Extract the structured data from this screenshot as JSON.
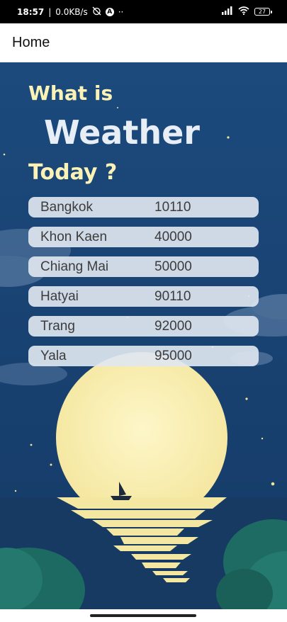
{
  "status_bar": {
    "time": "18:57",
    "network_speed": "0.0KB/s",
    "extra_dots": "··",
    "battery_level": "27"
  },
  "app_bar": {
    "title": "Home"
  },
  "header": {
    "line1": "What is",
    "line2": "Weather",
    "line3": "Today ?"
  },
  "cities": [
    {
      "name": "Bangkok",
      "code": "10110"
    },
    {
      "name": "Khon Kaen",
      "code": "40000"
    },
    {
      "name": "Chiang Mai",
      "code": "50000"
    },
    {
      "name": "Hatyai",
      "code": "90110"
    },
    {
      "name": "Trang",
      "code": "92000"
    },
    {
      "name": "Yala",
      "code": "95000"
    }
  ],
  "colors": {
    "sky": "#1a4577",
    "title_yellow": "#fbf3b6",
    "moon": "#fbf0b8",
    "row_background": "#dee6f0"
  }
}
